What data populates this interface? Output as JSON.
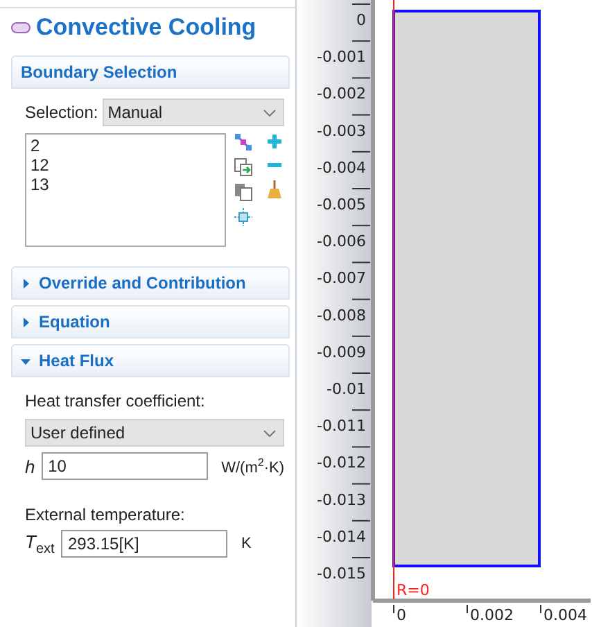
{
  "panel": {
    "title": "Convective Cooling",
    "sections": [
      {
        "kind": "selection",
        "title": "Boundary Selection",
        "selection_label": "Selection:",
        "selection_value": "Manual",
        "items": [
          "2",
          "12",
          "13"
        ]
      },
      {
        "kind": "collapsible",
        "title": "Override and Contribution",
        "expanded": false
      },
      {
        "kind": "collapsible",
        "title": "Equation",
        "expanded": false
      },
      {
        "kind": "heat_flux",
        "title": "Heat Flux",
        "expanded": true,
        "coefficient_label": "Heat transfer coefficient:",
        "coefficient_mode": "User defined",
        "fields": [
          {
            "symbol": "h",
            "value": "10",
            "unit": "W/(m$^{2}$·K)"
          },
          {
            "label": "External temperature:",
            "symbol": "T$_{ext}$",
            "value": "293.15[K]",
            "unit": "K"
          }
        ]
      }
    ]
  },
  "graphics": {
    "y_ticks": [
      "0",
      "-0.001",
      "-0.002",
      "-0.003",
      "-0.004",
      "-0.005",
      "-0.006",
      "-0.007",
      "-0.008",
      "-0.009",
      "-0.01",
      "-0.011",
      "-0.012",
      "-0.013",
      "-0.014",
      "-0.015"
    ],
    "x_ticks": [
      "0",
      "0.002",
      "0.004"
    ],
    "axis_label": "R=0"
  }
}
